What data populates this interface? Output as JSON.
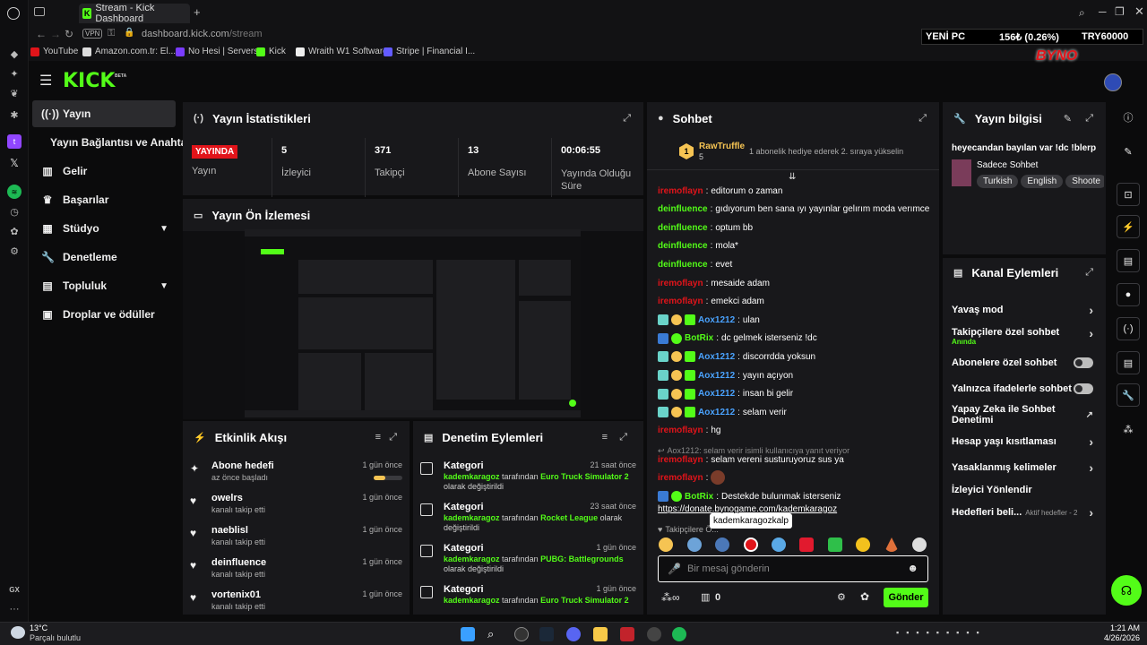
{
  "browser": {
    "tab_title": "Stream - Kick Dashboard",
    "url_host": "dashboard.kick.com",
    "url_path": "/stream",
    "vpn": "VPN",
    "bookmarks": [
      "YouTube",
      "Amazon.com.tr: El...",
      "No Hesi | Servers",
      "Kick",
      "Wraith W1 Software",
      "Stripe | Financial I..."
    ]
  },
  "ticker": {
    "name": "YENİ PC",
    "value": "156₺ (0.26%)",
    "target": "TRY60000"
  },
  "brand": {
    "logo": "KICK",
    "beta": "BETA",
    "stream_logo": "BYNO"
  },
  "sidebar": {
    "items": [
      {
        "label": "Yayın",
        "icon": "broadcast-icon"
      },
      {
        "label": "Yayın Bağlantısı ve Anahtarı",
        "icon": ""
      },
      {
        "label": "Gelir",
        "icon": "bar-chart-icon"
      },
      {
        "label": "Başarılar",
        "icon": "trophy-icon"
      },
      {
        "label": "Stüdyo",
        "icon": "studio-icon"
      },
      {
        "label": "Denetleme",
        "icon": "wrench-icon"
      },
      {
        "label": "Topluluk",
        "icon": "community-icon"
      },
      {
        "label": "Droplar ve ödüller",
        "icon": "gift-icon"
      }
    ]
  },
  "stats": {
    "title": "Yayın İstatistikleri",
    "live_badge": "YAYINDA",
    "live_label": "Yayın",
    "items": [
      {
        "value": "5",
        "label": "İzleyici"
      },
      {
        "value": "371",
        "label": "Takipçi"
      },
      {
        "value": "13",
        "label": "Abone Sayısı"
      },
      {
        "value": "00:06:55",
        "label": "Yayında Olduğu Süre"
      }
    ]
  },
  "preview": {
    "title": "Yayın Ön İzlemesi"
  },
  "activity": {
    "title": "Etkinlik Akışı",
    "items": [
      {
        "title": "Abone hedefi",
        "sub": "az önce başladı",
        "time": "1 gün önce",
        "progress": 0.4
      },
      {
        "title": "owelrs",
        "sub": "kanalı takip etti",
        "time": "1 gün önce"
      },
      {
        "title": "naeblisl",
        "sub": "kanalı takip etti",
        "time": "1 gün önce"
      },
      {
        "title": "deinfluence",
        "sub": "kanalı takip etti",
        "time": "1 gün önce"
      },
      {
        "title": "vortenix01",
        "sub": "kanalı takip etti",
        "time": "1 gün önce"
      }
    ]
  },
  "moderation": {
    "title": "Denetim Eylemleri",
    "items": [
      {
        "title": "Kategori",
        "user": "kademkaragoz",
        "mid": "tarafından",
        "game": "Euro Truck Simulator 2",
        "end": "olarak değiştirildi",
        "time": "21 saat önce"
      },
      {
        "title": "Kategori",
        "user": "kademkaragoz",
        "mid": "tarafından",
        "game": "Rocket League",
        "end": "olarak değiştirildi",
        "time": "23 saat önce"
      },
      {
        "title": "Kategori",
        "user": "kademkaragoz",
        "mid": "tarafından",
        "game": "PUBG: Battlegrounds",
        "end": "olarak değiştirildi",
        "time": "1 gün önce"
      },
      {
        "title": "Kategori",
        "user": "kademkaragoz",
        "mid": "tarafından",
        "game": "Euro Truck Simulator 2",
        "end": "",
        "time": "1 gün önce"
      }
    ]
  },
  "chat": {
    "title": "Sohbet",
    "pinned_user": "RawTruffle",
    "pinned_count": "5",
    "pinned_text": "1 abonelik hediye ederek 2. sıraya yükselin",
    "messages": [
      {
        "user": "iremoflayn",
        "text": "editorum o zaman",
        "style": "u1",
        "badges": 0
      },
      {
        "user": "deinfluence",
        "text": "gıdıyorum ben sana ıyı yayınlar gelırım moda verımce",
        "style": "u2",
        "badges": 0
      },
      {
        "user": "deinfluence",
        "text": "optum bb",
        "style": "u2",
        "badges": 0
      },
      {
        "user": "deinfluence",
        "text": "mola*",
        "style": "u2",
        "badges": 0
      },
      {
        "user": "deinfluence",
        "text": "evet",
        "style": "u2",
        "badges": 0
      },
      {
        "user": "iremoflayn",
        "text": "mesaide adam",
        "style": "u1",
        "badges": 0
      },
      {
        "user": "iremoflayn",
        "text": "emekci adam",
        "style": "u1",
        "badges": 0
      },
      {
        "user": "Aox1212",
        "text": "ulan",
        "style": "u3",
        "badges": 3
      },
      {
        "user": "BotRix",
        "text": "dc gelmek isterseniz !dc",
        "style": "u2",
        "badges": 2
      },
      {
        "user": "Aox1212",
        "text": "discorrdda yoksun",
        "style": "u3",
        "badges": 3
      },
      {
        "user": "Aox1212",
        "text": "yayın açıyon",
        "style": "u3",
        "badges": 3
      },
      {
        "user": "Aox1212",
        "text": "insan bi gelir",
        "style": "u3",
        "badges": 3
      },
      {
        "user": "Aox1212",
        "text": "selam verir",
        "style": "u3",
        "badges": 3
      },
      {
        "user": "iremoflayn",
        "text": "hg",
        "style": "u1",
        "badges": 0
      }
    ],
    "reply_note": "Aox1212: selam verir isimli kullanıcıya yanıt veriyor",
    "reply_user": "iremoflayn",
    "reply_text": "selam vereni susturuyoruz sus ya",
    "last_user": "iremoflayn",
    "bot_user": "BotRix",
    "bot_text": "Destekde bulunmak isterseniz",
    "bot_link": "https://donate.bynogame.com/kademkaragoz",
    "followers_only": "Takipçilere Ö...",
    "tooltip": "kademkaragozkalp",
    "input_placeholder": "Bir mesaj gönderin",
    "points": "0",
    "send": "Gönder"
  },
  "stream_info": {
    "title": "Yayın bilgisi",
    "stream_title": "heyecandan bayılan var !dc !blerp",
    "category": "Sadece Sohbet",
    "tags": [
      "Turkish",
      "English",
      "Shoote"
    ]
  },
  "channel_actions": {
    "title": "Kanal Eylemleri",
    "items": [
      {
        "label": "Yavaş mod",
        "control": "chevron"
      },
      {
        "label": "Takipçilere özel sohbet",
        "sub": "Anında",
        "control": "chevron"
      },
      {
        "label": "Abonelere özel sohbet",
        "control": "toggle"
      },
      {
        "label": "Yalnızca ifadelerle sohbet",
        "control": "toggle"
      },
      {
        "label": "Yapay Zeka ile Sohbet Denetimi",
        "control": "external"
      },
      {
        "label": "Hesap yaşı kısıtlaması",
        "control": "chevron"
      },
      {
        "label": "Yasaklanmış kelimeler",
        "control": "chevron"
      },
      {
        "label": "İzleyici Yönlendir",
        "control": "none"
      },
      {
        "label": "Hedefleri beli...",
        "sub": "Aktif hedefler - 2",
        "control": "chevron"
      }
    ]
  },
  "taskbar": {
    "temp": "13°C",
    "weather": "Parçalı bulutlu",
    "time": "1:21 AM",
    "date": "4/26/2026",
    "gx": "GX"
  },
  "colors": {
    "accent": "#53fc18",
    "live": "#e1141a",
    "panel": "#18181b",
    "bg": "#0b0b0c"
  }
}
